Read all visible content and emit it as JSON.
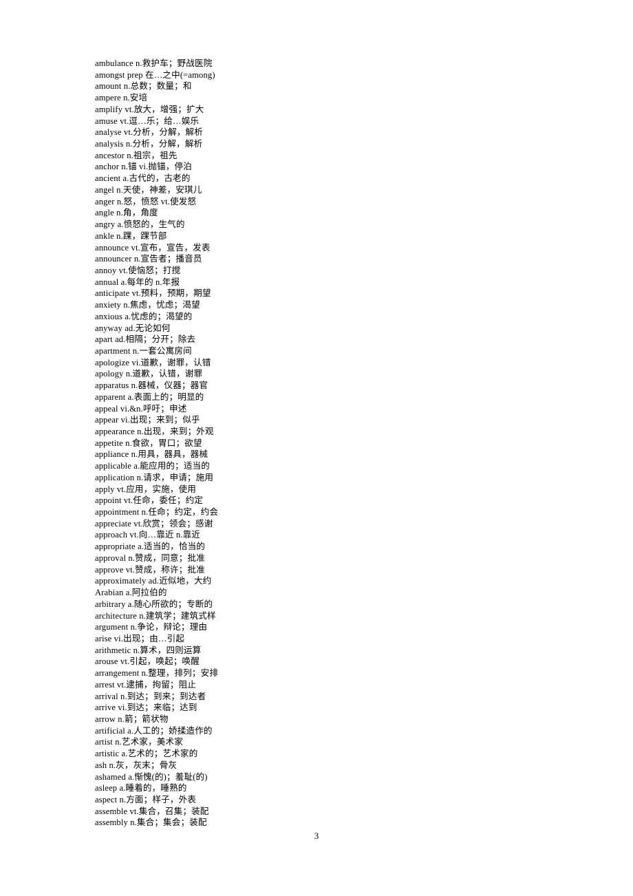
{
  "document": {
    "page_number": "3",
    "background_color": "#ffffff",
    "text_color": "#000000"
  },
  "wordlist": {
    "entries": [
      "ambulance n.救护车；野战医院",
      "amongst prep 在…之中(=among)",
      "amount n.总数；数量；和",
      "ampere n.安培",
      "amplify vt.放大，增强；扩大",
      "amuse vt.逗…乐；给…娱乐",
      "analyse vt.分析，分解，解析",
      "analysis n.分析，分解，解析",
      "ancestor n.祖宗，祖先",
      "anchor n.锚  vi.抛锚，停泊",
      "ancient a.古代的，古老的",
      "angel n.天使，神差，安琪儿",
      "anger n.怒，愤怒  vt.使发怒",
      "angle n.角，角度",
      "angry a.愤怒的，生气的",
      "ankle n.踝，踝节部",
      "announce vt.宣布，宣告，发表",
      "announcer n.宣告者；播音员",
      "annoy vt.使恼怒；打搅",
      "annual a.每年的  n.年报",
      "anticipate vt.预料，预期，期望",
      "anxiety n.焦虑，忧虑；渴望",
      "anxious a.忧虑的；渴望的",
      "anyway ad.无论如何",
      "apart ad.相隔；分开；除去",
      "apartment n.一套公寓房间",
      "apologize vi.道歉，谢罪，认错",
      "apology n.道歉，认错，谢罪",
      "apparatus n.器械，仪器；器官",
      "apparent a.表面上的；明显的",
      "appeal vi.&n.呼吁；申述",
      "appear vi.出现；来到；似乎",
      "appearance n.出现，来到；外观",
      "appetite n.食欲，胃口；欲望",
      "appliance n.用具，器具，器械",
      "applicable a.能应用的；适当的",
      "application n.请求，申请；施用",
      "apply vt.应用，实施，使用",
      "appoint vt.任命，委任；约定",
      "appointment n.任命；约定，约会",
      "appreciate vt.欣赏；领会；感谢",
      "approach vt.向…靠近  n.靠近",
      "appropriate a.适当的，恰当的",
      "approval n.赞成，同意；批准",
      "approve vt.赞成，称许；批准",
      "approximately ad.近似地，大约",
      "Arabian a.阿拉伯的",
      "arbitrary a.随心所欲的；专断的",
      "architecture n.建筑学；建筑式样",
      "argument n.争论，辩论；理由",
      "arise vi.出现；由…引起",
      "arithmetic n.算术，四则运算",
      "arouse vt.引起，唤起；唤醒",
      "arrangement n.整理，排列；安排",
      "arrest vt.逮捕，拘留；阻止",
      "arrival n.到达；到来；到达者",
      "arrive vi.到达；来临；达到",
      "arrow n.箭；箭状物",
      "artificial a.人工的；娇揉造作的",
      "artist n.艺术家，美术家",
      "artistic a.艺术的；艺术家的",
      "ash n.灰，灰末；骨灰",
      "ashamed a.惭愧(的)；羞耻(的)",
      "asleep a.睡着的，睡熟的",
      "aspect n.方面；样子，外表",
      "assemble vt.集合，召集；装配",
      "assembly n.集合；集会；装配"
    ]
  }
}
